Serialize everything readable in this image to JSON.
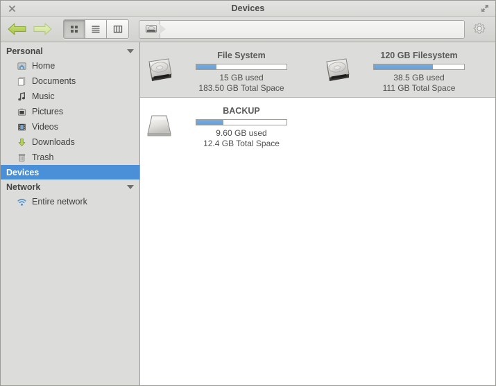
{
  "window": {
    "title": "Devices",
    "close_label": "✕",
    "close_icon": "close-icon",
    "maximize_icon": "maximize-icon"
  },
  "toolbar": {
    "back_icon": "arrow-left-icon",
    "forward_icon": "arrow-right-icon",
    "view_modes": [
      {
        "name": "icon-view",
        "icon": "grid-icon",
        "active": true
      },
      {
        "name": "list-view",
        "icon": "list-icon",
        "active": false
      },
      {
        "name": "column-view",
        "icon": "columns-icon",
        "active": false
      }
    ],
    "path": {
      "crumb_icon": "harddisk-icon",
      "crumb_label": "",
      "placeholder": ""
    },
    "settings_icon": "gear-icon"
  },
  "sidebar": {
    "sections": [
      {
        "label": "Personal",
        "expanded": true,
        "selected": false,
        "has_triangle": true,
        "items": [
          {
            "label": "Home",
            "icon": "home-icon"
          },
          {
            "label": "Documents",
            "icon": "documents-icon"
          },
          {
            "label": "Music",
            "icon": "music-note-icon"
          },
          {
            "label": "Pictures",
            "icon": "pictures-icon"
          },
          {
            "label": "Videos",
            "icon": "film-icon"
          },
          {
            "label": "Downloads",
            "icon": "download-arrow-icon"
          },
          {
            "label": "Trash",
            "icon": "trash-icon"
          }
        ]
      },
      {
        "label": "Devices",
        "expanded": false,
        "selected": true,
        "has_triangle": false,
        "items": []
      },
      {
        "label": "Network",
        "expanded": true,
        "selected": false,
        "has_triangle": true,
        "items": [
          {
            "label": "Entire network",
            "icon": "network-wifi-icon"
          }
        ]
      }
    ]
  },
  "main": {
    "devices": [
      {
        "name": "File System",
        "used": "15 GB used",
        "total": "183.50 GB Total Space",
        "fill_percent": 22,
        "icon": "internal-harddisk-icon",
        "band": true
      },
      {
        "name": "120 GB Filesystem",
        "used": "38.5 GB used",
        "total": "111 GB Total Space",
        "fill_percent": 65,
        "icon": "internal-harddisk-icon",
        "band": true
      },
      {
        "name": "BACKUP",
        "used": "9.60 GB used",
        "total": "12.4 GB Total Space",
        "fill_percent": 30,
        "icon": "external-drive-icon",
        "band": false
      }
    ]
  },
  "colors": {
    "selection_blue": "#4a90d9",
    "progress_blue": "#6aa0d8",
    "sidebar_bg": "#dcdcda",
    "band_bg": "#dcdcda",
    "content_bg": "#ffffff"
  }
}
